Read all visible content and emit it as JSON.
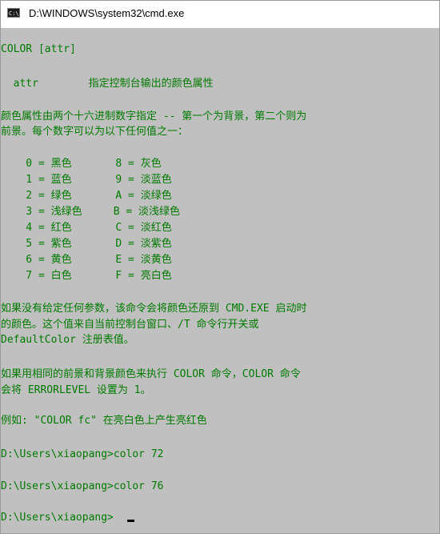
{
  "window": {
    "title": "D:\\WINDOWS\\system32\\cmd.exe",
    "icon_label": "C:\\",
    "background_color": "#c0c0c0",
    "text_color": "#007a00"
  },
  "console": {
    "lines": [
      "COLOR [attr]",
      "  attr        指定控制台输出的颜色属性",
      "颜色属性由两个十六进制数字指定 -- 第一个为背景，第二个则为",
      "前景。每个数字可以为以下任何值之一：",
      "    0 = 黑色       8 = 灰色",
      "    1 = 蓝色       9 = 淡蓝色",
      "    2 = 绿色       A = 淡绿色",
      "    3 = 浅绿色     B = 淡浅绿色",
      "    4 = 红色       C = 淡红色",
      "    5 = 紫色       D = 淡紫色",
      "    6 = 黄色       E = 淡黄色",
      "    7 = 白色       F = 亮白色",
      "如果没有给定任何参数，该命令会将颜色还原到 CMD.EXE 启动时",
      "的颜色。这个值来自当前控制台窗口、/T 命令行开关或",
      "DefaultColor 注册表值。",
      "如果用相同的前景和背景颜色来执行 COLOR 命令，COLOR 命令",
      "会将 ERRORLEVEL 设置为 1。",
      "例如: \"COLOR fc\" 在亮白色上产生亮红色",
      "D:\\Users\\xiaopang>color 72",
      "D:\\Users\\xiaopang>color 76",
      "D:\\Users\\xiaopang>"
    ]
  }
}
